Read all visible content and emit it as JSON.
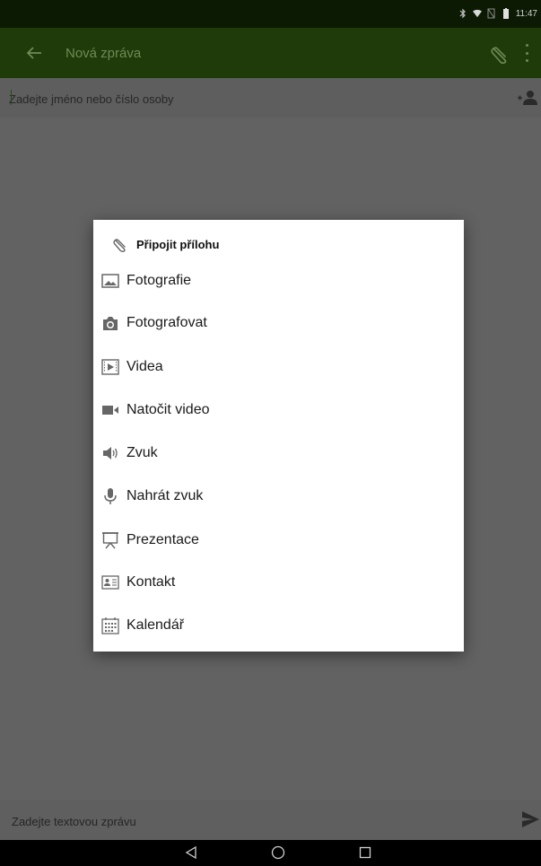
{
  "status_bar": {
    "time": "11:47"
  },
  "toolbar": {
    "title": "Nová zpráva",
    "back_icon": "arrow-back-icon",
    "attach_icon": "paperclip-icon",
    "more_icon": "more-vert-icon"
  },
  "recipient": {
    "placeholder": "Zadejte jméno nebo číslo osoby",
    "add_icon": "add-person-icon"
  },
  "compose": {
    "placeholder": "Zadejte textovou zprávu",
    "send_icon": "send-icon"
  },
  "dialog": {
    "title": "Připojit přílohu",
    "title_icon": "paperclip-icon",
    "items": [
      {
        "label": "Fotografie",
        "icon": "image-icon"
      },
      {
        "label": "Fotografovat",
        "icon": "camera-icon"
      },
      {
        "label": "Videa",
        "icon": "video-file-icon"
      },
      {
        "label": "Natočit video",
        "icon": "videocam-icon"
      },
      {
        "label": "Zvuk",
        "icon": "speaker-icon"
      },
      {
        "label": "Nahrát zvuk",
        "icon": "microphone-icon"
      },
      {
        "label": "Prezentace",
        "icon": "presentation-icon"
      },
      {
        "label": "Kontakt",
        "icon": "contact-card-icon"
      },
      {
        "label": "Kalendář",
        "icon": "calendar-icon"
      }
    ]
  },
  "colors": {
    "status_bar": "#0c1a04",
    "toolbar": "#1e3b09",
    "scrim_gray": "#626262",
    "dialog_bg": "#ffffff",
    "icon_gray": "#666666"
  }
}
